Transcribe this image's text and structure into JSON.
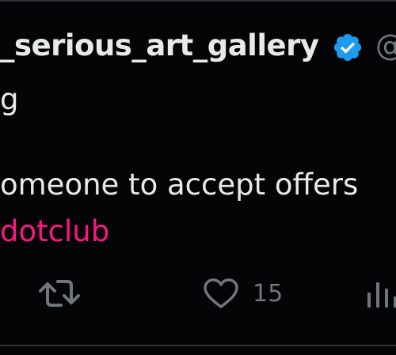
{
  "post": {
    "author": {
      "display_name": "_serious_art_gallery",
      "handle_start": "@",
      "second_line": "g",
      "verified": true
    },
    "body": {
      "line1": "omeone to accept offers",
      "link": "dotclub"
    },
    "actions": {
      "like_count": "15"
    }
  },
  "colors": {
    "background": "#000000",
    "text_primary": "#e7e9ea",
    "text_secondary": "#71767b",
    "link": "#f91880",
    "verified": "#1d9bf0",
    "border": "#2f3336"
  },
  "icons": {
    "verified": "verified-badge-icon",
    "retweet": "retweet-icon",
    "like": "heart-icon",
    "views": "views-icon"
  }
}
